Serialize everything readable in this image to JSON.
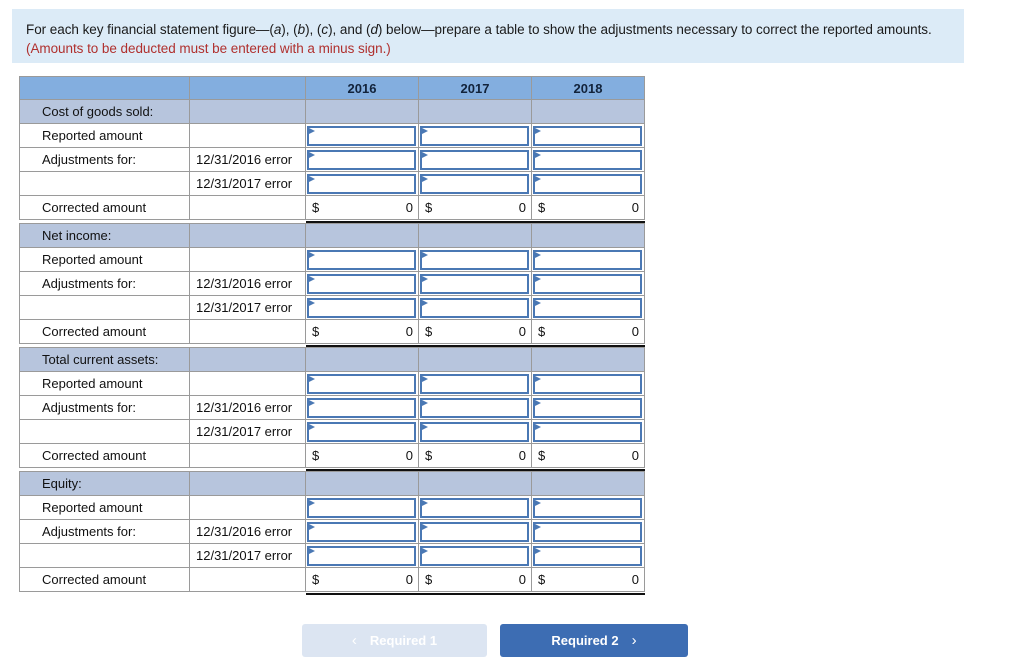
{
  "banner": {
    "line1_a": "For each key financial statement figure—(",
    "a": "a",
    "line1_b": "), (",
    "b": "b",
    "line1_c": "), (",
    "c": "c",
    "line1_d": "), and (",
    "d": "d",
    "line1_e": ") below—prepare a table to show the adjustments necessary to correct the reported amounts.",
    "note": "(Amounts to be deducted must be entered with a minus sign.)",
    "background_color": "#dcebf7",
    "note_color": "#b0302e"
  },
  "table": {
    "header": {
      "blank1": "",
      "blank2": "",
      "years": [
        "2016",
        "2017",
        "2018"
      ],
      "background_color": "#83aedf"
    },
    "section_background_color": "#b7c5dd",
    "input_border_color": "#4a78b4",
    "row_labels": {
      "reported": "Reported amount",
      "adjustments": "Adjustments for:",
      "corrected": "Corrected amount",
      "blank": ""
    },
    "sub_labels": {
      "error_2016": "12/31/2016 error",
      "error_2017": "12/31/2017 error",
      "blank": ""
    },
    "currency_symbol": "$",
    "corrected_value": "0",
    "sections": [
      {
        "title": "Cost of goods sold:"
      },
      {
        "title": "Net income:"
      },
      {
        "title": "Total current assets:"
      },
      {
        "title": "Equity:"
      }
    ]
  },
  "footer": {
    "prev_button": {
      "label": "Required 1",
      "icon": "chevron-left-icon",
      "glyph": "‹",
      "background_color": "#dce5f2",
      "disabled": true
    },
    "next_button": {
      "label": "Required 2",
      "icon": "chevron-right-icon",
      "glyph": "›",
      "background_color": "#3d6db3",
      "disabled": false
    }
  }
}
